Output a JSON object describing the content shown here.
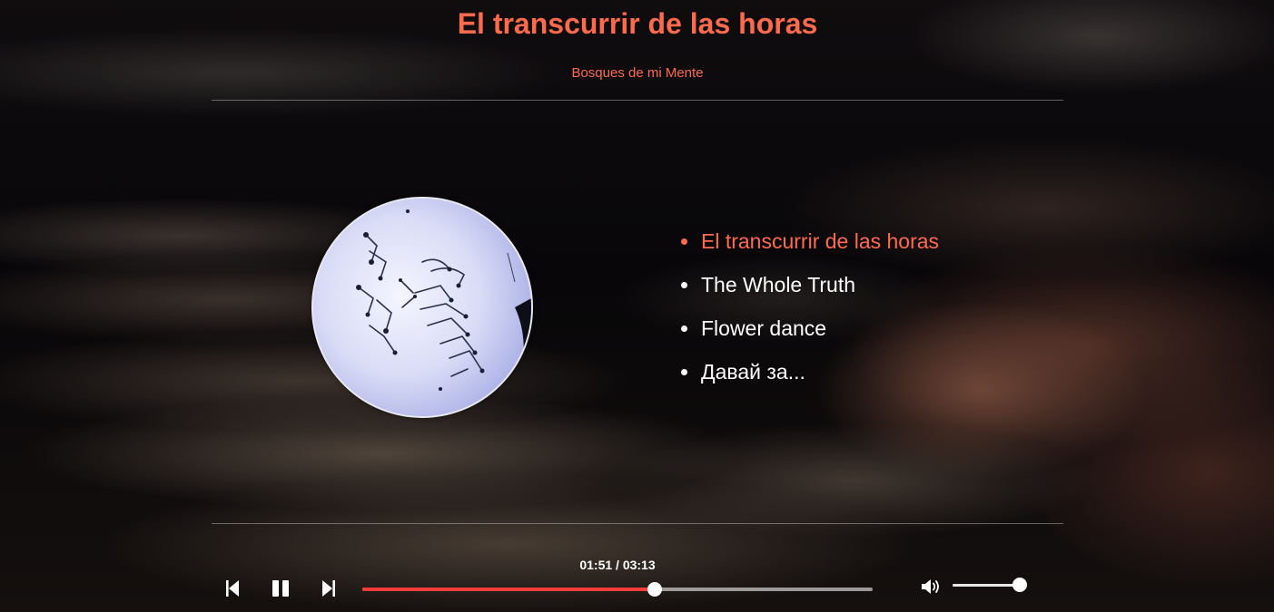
{
  "header": {
    "song_title": "El transcurrir de las horas",
    "album_title": "Bosques de mi Mente"
  },
  "cover": {
    "icon": "album-cover-art"
  },
  "playlist": {
    "items": [
      {
        "label": "El transcurrir de las horas",
        "active": true
      },
      {
        "label": "The Whole Truth",
        "active": false
      },
      {
        "label": "Flower dance",
        "active": false
      },
      {
        "label": "Давай за...",
        "active": false
      }
    ]
  },
  "player": {
    "current_time": "01:51",
    "total_time": "03:13",
    "time_display": "01:51 / 03:13",
    "progress_fraction": 0.5735,
    "volume_fraction": 1.0,
    "icons": {
      "previous": "skip-previous-icon",
      "pause": "pause-icon",
      "next": "skip-next-icon",
      "volume": "volume-icon"
    }
  },
  "colors": {
    "accent": "#ff6a4d",
    "progress": "#ff3b3b",
    "text": "#ffffff"
  }
}
